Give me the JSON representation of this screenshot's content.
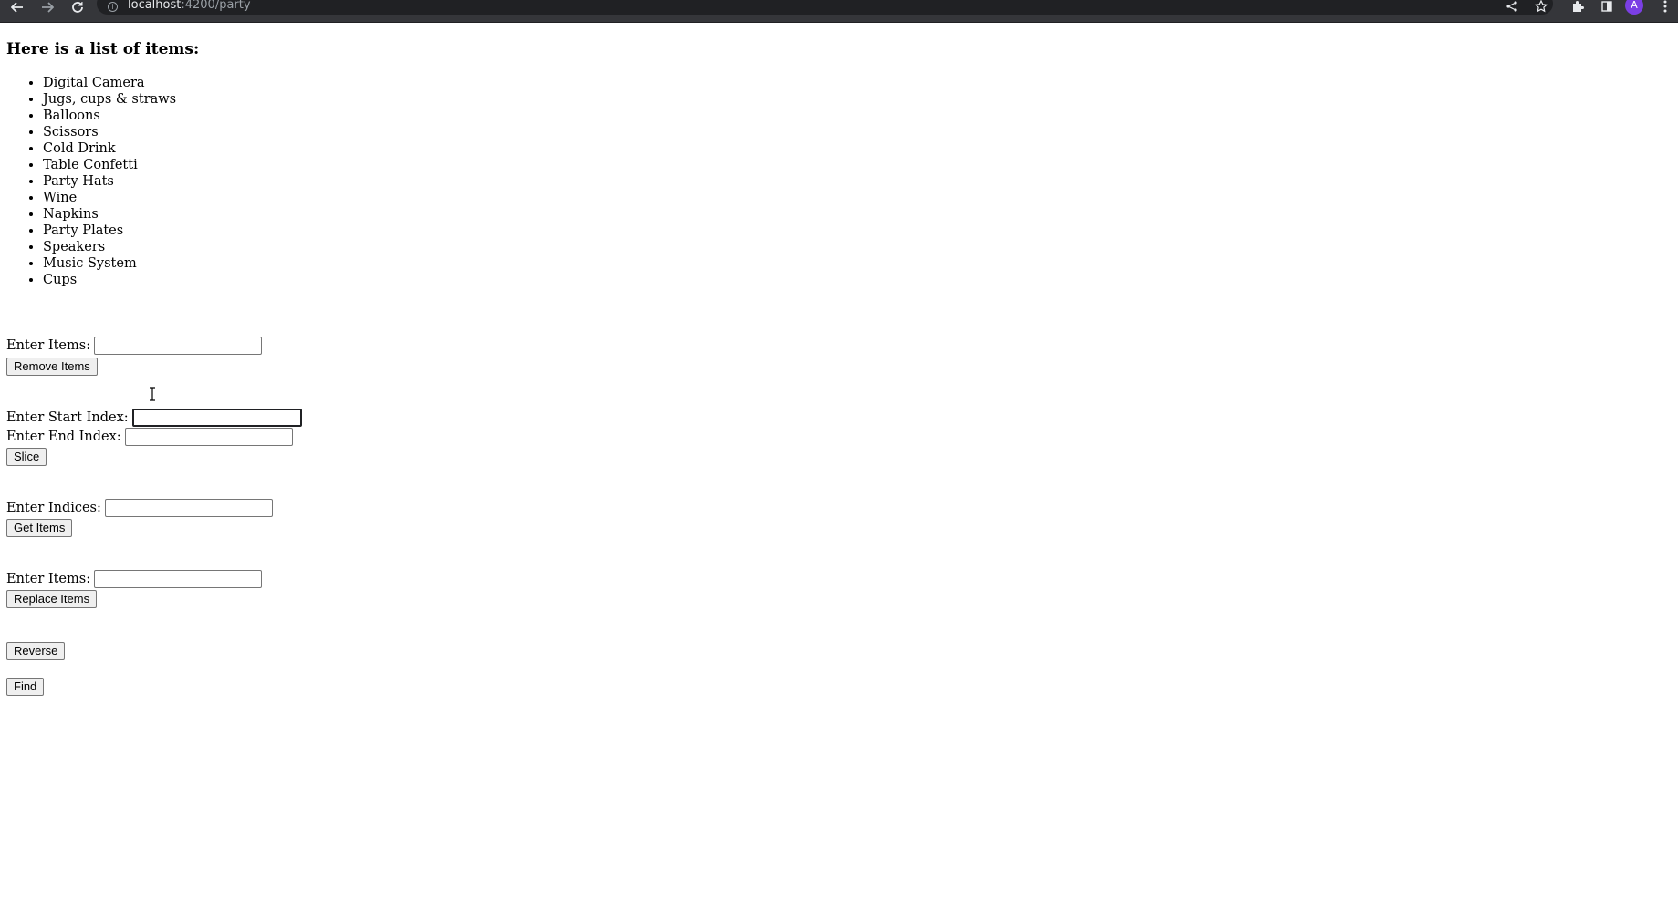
{
  "browser": {
    "url_host": "localhost",
    "url_rest": ":4200/party",
    "avatar_letter": "A",
    "icons": [
      "back-arrow-icon",
      "forward-arrow-icon",
      "reload-icon",
      "info-icon",
      "share-icon",
      "star-icon",
      "extensions-icon",
      "side-panel-icon",
      "menu-icon"
    ]
  },
  "page": {
    "title": "Here is a list of items:",
    "items": [
      "Digital Camera",
      "Jugs, cups & straws",
      "Balloons",
      "Scissors",
      "Cold Drink",
      "Table Confetti",
      "Party Hats",
      "Wine",
      "Napkins",
      "Party Plates",
      "Speakers",
      "Music System",
      "Cups"
    ],
    "remove": {
      "label": "Enter Items:",
      "value": "",
      "button": "Remove Items"
    },
    "slice": {
      "start_label": "Enter Start Index:",
      "start_value": "",
      "end_label": "Enter End Index:",
      "end_value": "",
      "button": "Slice"
    },
    "get": {
      "label": "Enter Indices:",
      "value": "",
      "button": "Get Items"
    },
    "replace": {
      "label": "Enter Items:",
      "value": "",
      "button": "Replace Items"
    },
    "reverse_button": "Reverse",
    "find_button": "Find"
  },
  "colors": {
    "chrome_bg": "#35363a",
    "omnibox_bg": "#202124",
    "avatar_bg": "#7b3fe4"
  }
}
